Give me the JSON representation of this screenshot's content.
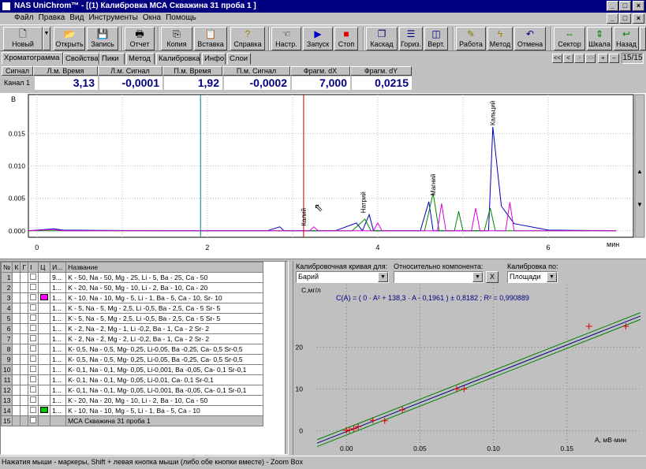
{
  "window": {
    "title": "NAS UniChrom™ - [(1) Калибровка МСА Скважина 31 проба 1 ]",
    "min_icon": "minimize-icon",
    "max_icon": "maximize-icon",
    "close_icon": "close-icon"
  },
  "menu": [
    "Файл",
    "Правка",
    "Вид",
    "Инструменты",
    "Окна",
    "Помощь"
  ],
  "toolbar": [
    {
      "label": "Новый",
      "icon": "new-doc-icon"
    },
    {
      "label": "Открыть",
      "icon": "open-folder-icon"
    },
    {
      "label": "Запись",
      "icon": "save-disk-icon"
    },
    {
      "label": "Отчет",
      "icon": "print-icon"
    },
    {
      "label": "Копия",
      "icon": "copy-icon"
    },
    {
      "label": "Вставка",
      "icon": "paste-icon"
    },
    {
      "label": "Справка",
      "icon": "help-icon"
    },
    {
      "label": "Настр.",
      "icon": "settings-hand-icon"
    },
    {
      "label": "Запуск",
      "icon": "play-icon"
    },
    {
      "label": "Стоп",
      "icon": "stop-icon"
    },
    {
      "label": "Каскад",
      "icon": "cascade-icon"
    },
    {
      "label": "Гориз.",
      "icon": "tile-horizontal-icon"
    },
    {
      "label": "Верт.",
      "icon": "tile-vertical-icon"
    },
    {
      "label": "Работа",
      "icon": "work-icon"
    },
    {
      "label": "Метод",
      "icon": "method-icon"
    },
    {
      "label": "Отмена",
      "icon": "undo-icon"
    },
    {
      "label": "Сектор",
      "icon": "sector-icon"
    },
    {
      "label": "Шкала",
      "icon": "scale-icon"
    },
    {
      "label": "Назад",
      "icon": "back-icon"
    }
  ],
  "tabs": [
    "Хроматограмма",
    "Свойства",
    "Пики",
    "Метод",
    "Калибровка",
    "Инфо",
    "Слои"
  ],
  "nav": {
    "buttons": [
      "<<",
      "<",
      ">",
      ">>",
      "+",
      "–"
    ],
    "page": "15/15"
  },
  "measure": {
    "headers": [
      "Сигнал",
      "Л.м. Время",
      "Л.м. Сигнал",
      "П.м. Время",
      "П.м. Сигнал",
      "Фрагм. dX",
      "Фрагм. dY"
    ],
    "channel": "Канал 1",
    "values": [
      "3,13",
      "-0,0001",
      "1,92",
      "-0,0002",
      "7,000",
      "0,0215"
    ]
  },
  "chart_data": [
    {
      "type": "line",
      "ylabel": "В",
      "xlabel": "мин",
      "xlim": [
        -0.1,
        7.0
      ],
      "ylim": [
        -0.001,
        0.021
      ],
      "y_ticks": [
        "0.000",
        "0.005",
        "0.010",
        "0.015"
      ],
      "x_ticks": [
        "0",
        "2",
        "4",
        "6"
      ],
      "markers": [
        {
          "x": 1.92,
          "color": "#008080"
        },
        {
          "x": 3.13,
          "color": "#c00000"
        }
      ],
      "peak_labels": [
        {
          "text": "Калий",
          "x": 3.13,
          "y": 0.0005
        },
        {
          "text": "Натрий",
          "x": 3.83,
          "y": 0.0025
        },
        {
          "text": "Магний",
          "x": 4.65,
          "y": 0.0052
        },
        {
          "text": "Кальций",
          "x": 5.35,
          "y": 0.016
        }
      ],
      "series": [
        {
          "color": "#0000c0",
          "points": [
            [
              -0.1,
              0.0
            ],
            [
              0.2,
              0.0003
            ],
            [
              0.3,
              0.0001
            ],
            [
              1.5,
              0.0
            ],
            [
              2.7,
              0.0
            ],
            [
              2.85,
              0.0006
            ],
            [
              2.9,
              0.0
            ],
            [
              3.5,
              0.0
            ],
            [
              3.75,
              0.0012
            ],
            [
              3.82,
              0.0
            ],
            [
              3.9,
              0.0025
            ],
            [
              3.95,
              0.0
            ],
            [
              4.5,
              0.0
            ],
            [
              4.6,
              0.0045
            ],
            [
              4.65,
              0.0
            ],
            [
              5.3,
              0.0
            ],
            [
              5.35,
              0.016
            ],
            [
              5.45,
              0.0038
            ],
            [
              5.6,
              0.0011
            ],
            [
              6.0,
              0.0001
            ],
            [
              6.8,
              0.0
            ]
          ]
        },
        {
          "color": "#008000",
          "points": [
            [
              -0.1,
              0.0
            ],
            [
              3.7,
              0.0
            ],
            [
              3.85,
              0.0018
            ],
            [
              3.92,
              0.0
            ],
            [
              4.55,
              0.0
            ],
            [
              4.65,
              0.0058
            ],
            [
              4.72,
              0.0
            ],
            [
              4.9,
              0.0
            ],
            [
              4.95,
              0.003
            ],
            [
              5.0,
              0.0
            ],
            [
              5.25,
              0.0
            ],
            [
              5.32,
              0.0035
            ],
            [
              5.38,
              0.0
            ],
            [
              6.8,
              0.0
            ]
          ]
        },
        {
          "color": "#e000e0",
          "points": [
            [
              -0.1,
              0.0
            ],
            [
              0.2,
              0.0002
            ],
            [
              0.3,
              0.0
            ],
            [
              3.2,
              0.0
            ],
            [
              3.25,
              0.0006
            ],
            [
              3.3,
              0.0
            ],
            [
              3.95,
              0.0
            ],
            [
              4.0,
              0.0012
            ],
            [
              4.05,
              0.0
            ],
            [
              4.7,
              0.0
            ],
            [
              4.75,
              0.0042
            ],
            [
              4.8,
              0.0
            ],
            [
              5.1,
              0.0
            ],
            [
              5.15,
              0.0035
            ],
            [
              5.2,
              0.0
            ],
            [
              5.5,
              0.0
            ],
            [
              5.55,
              0.0044
            ],
            [
              5.6,
              0.0
            ],
            [
              6.8,
              0.0
            ]
          ]
        }
      ]
    },
    {
      "type": "scatter",
      "ylabel": "С,мг/л",
      "xlabel": "А, мВ·мин",
      "equation": "C(A) = ( 0 · A² + 138,3 · A - 0,1961 ) ± 0,8182 ;  R² = 0,990889",
      "xlim": [
        -0.02,
        0.2
      ],
      "ylim": [
        -5,
        35
      ],
      "x_ticks": [
        "0.00",
        "0.05",
        "0.10",
        "0.15"
      ],
      "y_ticks": [
        "0",
        "10",
        "20"
      ],
      "points": [
        [
          0.0,
          0.1
        ],
        [
          0.002,
          0.2
        ],
        [
          0.005,
          0.5
        ],
        [
          0.008,
          1.0
        ],
        [
          0.018,
          2.5
        ],
        [
          0.026,
          2.4
        ],
        [
          0.038,
          5.0
        ],
        [
          0.075,
          10.0
        ],
        [
          0.08,
          10.0
        ],
        [
          0.165,
          25.0
        ],
        [
          0.19,
          25.0
        ]
      ]
    }
  ],
  "table": {
    "headers": [
      "№",
      "К",
      "Г",
      "I",
      "Ц",
      "И...",
      "Название"
    ],
    "rows": [
      {
        "n": "1",
        "c": "",
        "f": "9...",
        "name": "K - 50, Na - 50, Mg - 25, Li - 5,   Ba - 25,  Ca - 50"
      },
      {
        "n": "2",
        "c": "",
        "f": "1...",
        "name": "K - 20, Na - 50, Mg - 10, Li - 2,   Ba - 10,  Ca - 20"
      },
      {
        "n": "3",
        "c": "#ff00ff",
        "f": "1...",
        "name": "K - 10, Na - 10, Mg -  5, Li - 1,   Ba -  5,  Ca - 10,  Sr- 10"
      },
      {
        "n": "4",
        "c": "",
        "f": "1...",
        "name": "K -  5,  Na -  5, Mg - 2,5, Li -0,5, Ba - 2,5, Ca -  5   Sr-  5"
      },
      {
        "n": "5",
        "c": "",
        "f": "1...",
        "name": "K -  5,  Na -  5, Mg - 2,5, Li -0,5, Ba - 2,5, Ca -  5   Sr-  5"
      },
      {
        "n": "6",
        "c": "",
        "f": "1...",
        "name": "K -  2,  Na -  2, Mg -   1, Li -0,2, Ba -  1,  Ca -  2   Sr-  2"
      },
      {
        "n": "7",
        "c": "",
        "f": "1...",
        "name": "K -  2,  Na -  2, Mg -   2, Li -0,2, Ba -  1,  Ca -  2   Sr-  2"
      },
      {
        "n": "8",
        "c": "",
        "f": "1...",
        "name": "K- 0,5, Na - 0,5, Mg- 0,25, Li-0,05, Ba -0,25, Ca- 0,5 Sr-0,5"
      },
      {
        "n": "9",
        "c": "",
        "f": "1...",
        "name": "K- 0,5, Na - 0,5, Mg- 0,25, Li-0,05, Ba -0,25, Ca- 0,5 Sr-0,5"
      },
      {
        "n": "10",
        "c": "",
        "f": "1...",
        "name": "K- 0,1, Na - 0,1, Mg- 0,05, Li-0,001, Ba -0,05, Ca- 0,1 Sr-0,1"
      },
      {
        "n": "11",
        "c": "",
        "f": "1...",
        "name": "K- 0,1, Na - 0,1, Mg- 0,05, Li-0,01,                Ca- 0,1 Sr-0,1"
      },
      {
        "n": "12",
        "c": "",
        "f": "1...",
        "name": "K- 0,1, Na - 0,1, Mg- 0,05, Li-0,001, Ba -0,05, Ca- 0,1 Sr-0,1"
      },
      {
        "n": "13",
        "c": "",
        "f": "1...",
        "name": "K - 20, Na - 20, Mg - 10,  Li - 2,    Ba - 10,  Ca - 50"
      },
      {
        "n": "14",
        "c": "#00c000",
        "f": "1...",
        "name": "K - 10, Na - 10, Mg -  5,   Li - 1,    Ba -  5,   Ca - 10"
      },
      {
        "n": "15",
        "c": "",
        "f": "",
        "name": "МСА Скважина 31 проба 1"
      }
    ]
  },
  "calibration": {
    "curve_label": "Калибровочная кривая для:",
    "curve_value": "Барий",
    "relative_label": "Относительно компонента:",
    "relative_value": "",
    "clear_button": "X",
    "by_label": "Калибровка по:",
    "by_value": "Площади"
  },
  "status": "Нажатия мыши - маркеры, Shift + левая кнопка мыши  (либо обе кнопки вместе) - Zoom Box"
}
